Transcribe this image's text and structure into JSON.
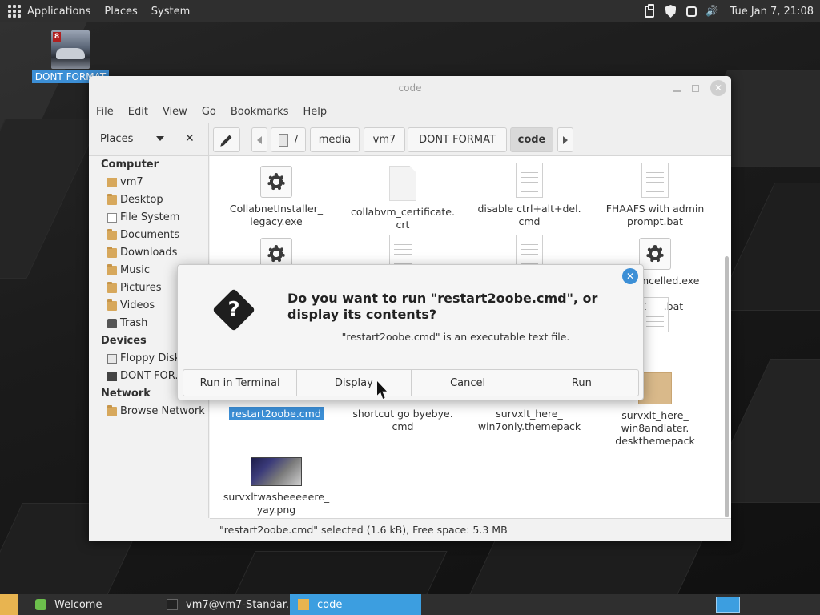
{
  "top_panel": {
    "menus": [
      "Applications",
      "Places",
      "System"
    ],
    "tray_icons": [
      "clipboard-icon",
      "shield-icon",
      "window-icon",
      "volume-icon"
    ],
    "clock": "Tue Jan  7, 21:08"
  },
  "desktop": {
    "icon_label": "DONT FORMAT"
  },
  "window": {
    "title": "code",
    "menubar": [
      "File",
      "Edit",
      "View",
      "Go",
      "Bookmarks",
      "Help"
    ],
    "places_header": "Places",
    "breadcrumbs": [
      "/",
      "media",
      "vm7",
      "DONT FORMAT",
      "code"
    ],
    "sidebar": {
      "computer": {
        "title": "Computer",
        "items": [
          "vm7",
          "Desktop",
          "File System",
          "Documents",
          "Downloads",
          "Music",
          "Pictures",
          "Videos",
          "Trash"
        ]
      },
      "devices": {
        "title": "Devices",
        "items": [
          "Floppy Disk",
          "DONT FOR..."
        ]
      },
      "network": {
        "title": "Network",
        "items": [
          "Browse Network"
        ]
      }
    },
    "files": [
      {
        "name": "CollabnetInstaller_\nlegacy.exe"
      },
      {
        "name": "collabvm_certificate.\ncrt"
      },
      {
        "name": "disable ctrl+alt+del.\ncmd"
      },
      {
        "name": "FHAAFS with admin\nprompt.bat"
      },
      {
        "name": "ancelled.exe"
      },
      {
        "name": "120.bat"
      },
      {
        "name": "restart2oobe.cmd"
      },
      {
        "name": "shortcut go byebye.\ncmd"
      },
      {
        "name": "survxlt_here_\nwin7only.themepack"
      },
      {
        "name": "survxlt_here_\nwin8andlater.\ndeskthemepack"
      },
      {
        "name": "survxltwasheeeeere_\nyay.png"
      }
    ],
    "status": "\"restart2oobe.cmd\" selected (1.6 kB), Free space: 5.3 MB"
  },
  "dialog": {
    "title": "Do you want to run \"restart2oobe.cmd\", or display its contents?",
    "subtitle": "\"restart2oobe.cmd\" is an executable text file.",
    "buttons": [
      "Run in Terminal",
      "Display",
      "Cancel",
      "Run"
    ]
  },
  "taskbar": {
    "items": [
      "Welcome",
      "vm7@vm7-Standar...",
      "code"
    ]
  }
}
